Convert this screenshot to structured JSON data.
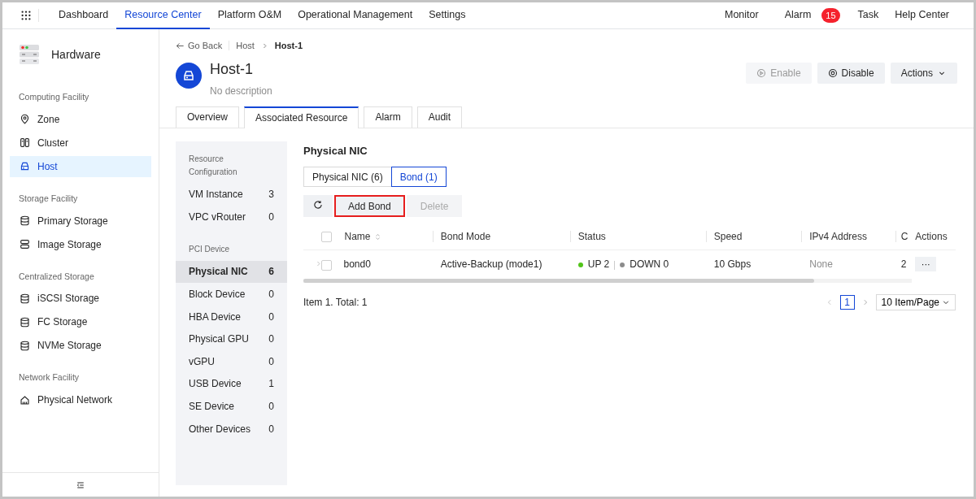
{
  "top_nav": {
    "items": [
      {
        "label": "Dashboard",
        "selected": false
      },
      {
        "label": "Resource Center",
        "selected": true
      },
      {
        "label": "Platform O&M",
        "selected": false
      },
      {
        "label": "Operational Management",
        "selected": false
      },
      {
        "label": "Settings",
        "selected": false
      }
    ],
    "right": [
      {
        "label": "Monitor"
      },
      {
        "label": "Alarm",
        "badge": "15"
      },
      {
        "label": "Task"
      },
      {
        "label": "Help Center"
      }
    ]
  },
  "sidebar": {
    "title": "Hardware",
    "groups": [
      {
        "label": "Computing Facility",
        "items": [
          {
            "label": "Zone",
            "kind": "pin",
            "selected": false
          },
          {
            "label": "Cluster",
            "kind": "cluster",
            "selected": false
          },
          {
            "label": "Host",
            "kind": "host",
            "selected": true
          }
        ]
      },
      {
        "label": "Storage Facility",
        "items": [
          {
            "label": "Primary Storage",
            "kind": "disk",
            "selected": false
          },
          {
            "label": "Image Storage",
            "kind": "stack",
            "selected": false
          }
        ]
      },
      {
        "label": "Centralized Storage",
        "items": [
          {
            "label": "iSCSI Storage",
            "kind": "disk",
            "selected": false
          },
          {
            "label": "FC Storage",
            "kind": "disk",
            "selected": false
          },
          {
            "label": "NVMe Storage",
            "kind": "disk",
            "selected": false
          }
        ]
      },
      {
        "label": "Network Facility",
        "items": [
          {
            "label": "Physical Network",
            "kind": "network",
            "selected": false
          }
        ]
      }
    ]
  },
  "breadcrumb": {
    "back": "Go Back",
    "items": [
      "Host",
      "Host-1"
    ]
  },
  "header": {
    "title": "Host-1",
    "description": "No description",
    "buttons": [
      {
        "label": "Enable",
        "kind": "play",
        "disabled": true
      },
      {
        "label": "Disable",
        "kind": "stop",
        "disabled": false
      },
      {
        "label": "Actions",
        "kind": "caret",
        "disabled": false
      }
    ]
  },
  "tabs": [
    {
      "label": "Overview",
      "selected": false
    },
    {
      "label": "Associated Resource",
      "selected": true
    },
    {
      "label": "Alarm",
      "selected": false
    },
    {
      "label": "Audit",
      "selected": false
    }
  ],
  "resource_panel": {
    "groups": [
      {
        "label": "Resource Configuration",
        "items": [
          {
            "label": "VM Instance",
            "count": "3",
            "selected": false
          },
          {
            "label": "VPC vRouter",
            "count": "0",
            "selected": false
          }
        ]
      },
      {
        "label": "PCI Device",
        "items": [
          {
            "label": "Physical NIC",
            "count": "6",
            "selected": true
          },
          {
            "label": "Block Device",
            "count": "0",
            "selected": false
          },
          {
            "label": "HBA Device",
            "count": "0",
            "selected": false
          },
          {
            "label": "Physical GPU",
            "count": "0",
            "selected": false
          },
          {
            "label": "vGPU",
            "count": "0",
            "selected": false
          },
          {
            "label": "USB Device",
            "count": "1",
            "selected": false
          },
          {
            "label": "SE Device",
            "count": "0",
            "selected": false
          },
          {
            "label": "Other Devices",
            "count": "0",
            "selected": false
          }
        ]
      }
    ]
  },
  "section": {
    "title": "Physical NIC",
    "segments": [
      {
        "label": "Physical NIC (6)",
        "selected": false
      },
      {
        "label": "Bond (1)",
        "selected": true
      }
    ],
    "toolbar": [
      {
        "kind": "refresh",
        "disabled": false,
        "highlighted": false
      },
      {
        "kind": "text",
        "label": "Add Bond",
        "disabled": false,
        "highlighted": true
      },
      {
        "kind": "text",
        "label": "Delete",
        "disabled": true,
        "highlighted": false
      }
    ]
  },
  "table": {
    "all_checked": false,
    "columns": [
      "Name",
      "Bond Mode",
      "Status",
      "Speed",
      "IPv4 Address",
      "C",
      "Actions"
    ],
    "rows": [
      {
        "checked": false,
        "name": "bond0",
        "bond_mode": "Active-Backup (mode1)",
        "status": [
          {
            "label": "UP 2",
            "color": "#52c41a"
          },
          {
            "label": "DOWN 0",
            "color": "#8c8c8c"
          }
        ],
        "speed": "10 Gbps",
        "ipv4": "None",
        "column_6": "2",
        "actions": "···"
      }
    ]
  },
  "pagination": {
    "summary": "Item 1. Total: 1",
    "pages": [
      {
        "label": "1",
        "selected": true
      }
    ],
    "page_size": "10 Item/Page"
  }
}
